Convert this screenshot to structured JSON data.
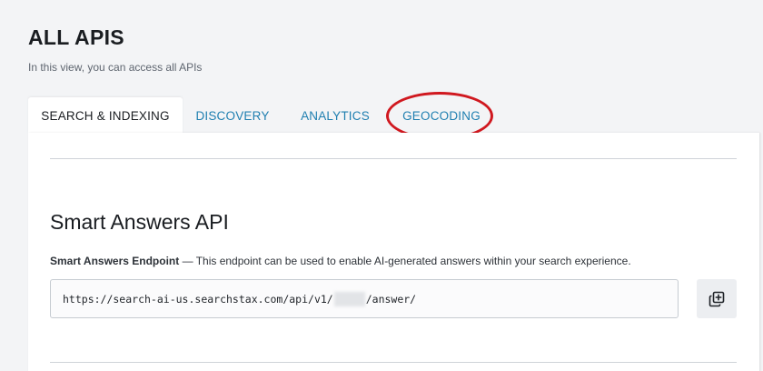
{
  "page": {
    "title": "ALL APIS",
    "subtitle": "In this view, you can access all APIs"
  },
  "tabs": [
    {
      "label": "SEARCH & INDEXING",
      "active": true
    },
    {
      "label": "DISCOVERY",
      "active": false
    },
    {
      "label": "ANALYTICS",
      "active": false
    },
    {
      "label": "GEOCODING",
      "active": false,
      "highlighted": true
    }
  ],
  "section": {
    "title": "Smart Answers API",
    "endpoint_label": "Smart Answers Endpoint",
    "endpoint_description": " — This endpoint can be used to enable AI-generated answers within your search experience.",
    "endpoint_url_prefix": "https://search-ai-us.searchstax.com/api/v1/",
    "endpoint_url_suffix": "/answer/",
    "copy_icon": "copy-plus-icon"
  },
  "colors": {
    "tab_link": "#1f7fb0",
    "highlight_ring": "#d0181f",
    "background": "#f3f4f6"
  }
}
